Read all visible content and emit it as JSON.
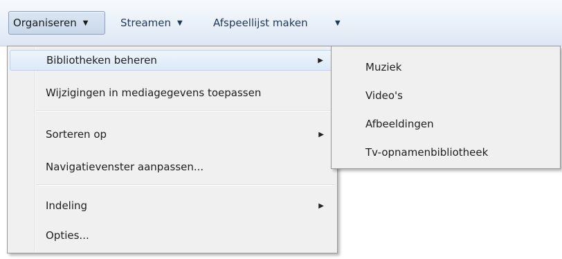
{
  "toolbar": {
    "organise_label": "Organiseren",
    "stream_label": "Streamen",
    "playlist_label": "Afspeellijst maken",
    "dropdown_glyph": "▼"
  },
  "organise_menu": {
    "items": [
      {
        "label": "Bibliotheken beheren",
        "submenu": true
      },
      {
        "label": "Wijzigingen in mediagegevens toepassen",
        "submenu": false
      },
      {
        "label": "Sorteren op",
        "submenu": true
      },
      {
        "label": "Navigatievenster aanpassen...",
        "submenu": false
      },
      {
        "label": "Indeling",
        "submenu": true
      },
      {
        "label": "Opties...",
        "submenu": false
      }
    ],
    "submenu_glyph": "▶"
  },
  "libraries_submenu": {
    "items": [
      {
        "label": "Muziek"
      },
      {
        "label": "Video's"
      },
      {
        "label": "Afbeeldingen"
      },
      {
        "label": "Tv-opnamenbibliotheek"
      }
    ]
  },
  "colors": {
    "toolbar_text": "#1e395b",
    "menu_background": "#f0f0f0",
    "highlight_border": "#b8d2ef"
  }
}
